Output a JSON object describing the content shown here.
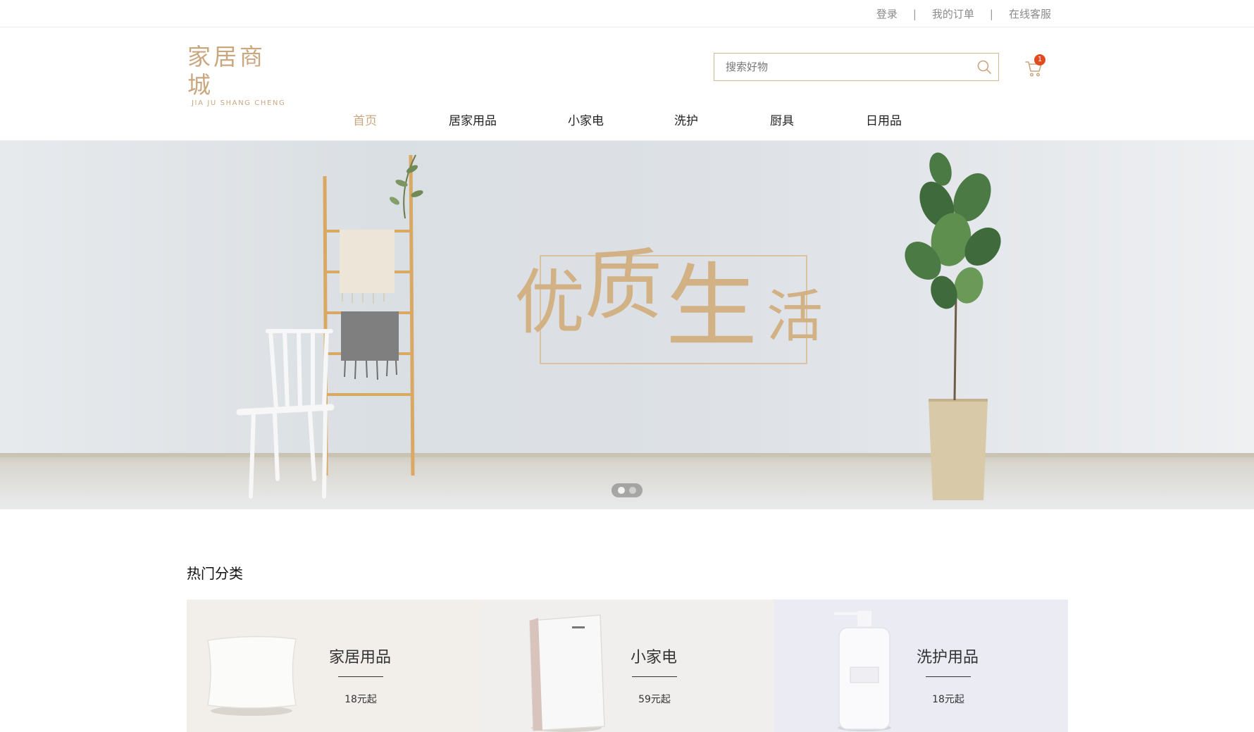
{
  "top_links": {
    "login": "登录",
    "separator": "|",
    "orders": "我的订单",
    "service": "在线客服"
  },
  "logo": {
    "cn": "家居商城",
    "en": "JIA JU SHANG CHENG"
  },
  "search": {
    "placeholder": "搜索好物",
    "value": ""
  },
  "cart": {
    "count": "1"
  },
  "nav": {
    "items": [
      "首页",
      "居家用品",
      "小家电",
      "洗护",
      "厨具",
      "日用品"
    ],
    "active": "首页"
  },
  "banner": {
    "slogan": [
      "优",
      "质",
      "生",
      "活"
    ],
    "slides": 2,
    "active_slide": 1
  },
  "hot_categories": {
    "title": "热门分类",
    "items": [
      {
        "name": "家居用品",
        "price": "18元起"
      },
      {
        "name": "小家电",
        "price": "59元起"
      },
      {
        "name": "洗护用品",
        "price": "18元起"
      }
    ]
  },
  "colors": {
    "accent": "#c9a77f",
    "badge": "#e24a1f",
    "text": "#333333"
  }
}
